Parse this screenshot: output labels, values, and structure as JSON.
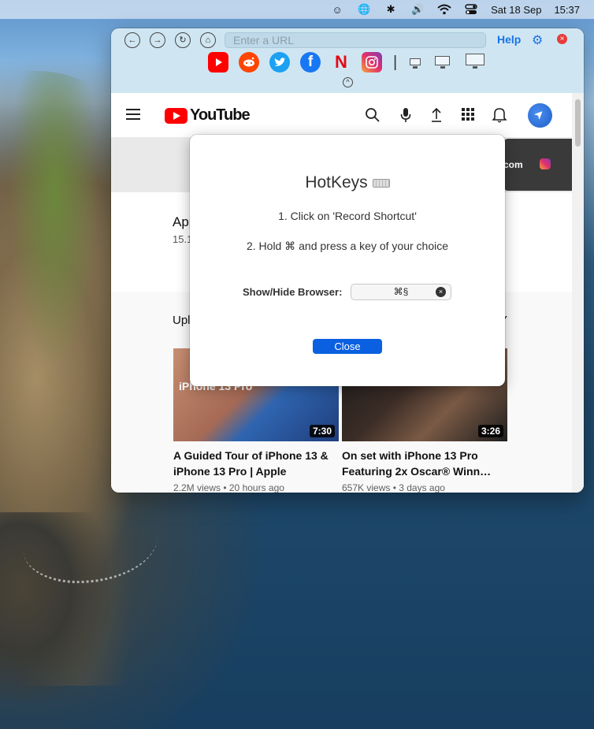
{
  "menubar": {
    "date": "Sat 18 Sep",
    "time": "15:37",
    "icons": [
      "app-icon",
      "globe-icon",
      "bluetooth-icon",
      "volume-icon",
      "wifi-icon",
      "control-center-icon"
    ]
  },
  "toolbar": {
    "url_placeholder": "Enter a URL",
    "help_label": "Help",
    "shortcuts": [
      "YouTube",
      "Reddit",
      "Twitter",
      "Facebook",
      "Netflix",
      "Instagram"
    ],
    "colors": {
      "youtube": "#ff0000",
      "reddit": "#ff4500",
      "twitter": "#1da1f2",
      "facebook": "#1877f2",
      "netflix": "#e50914",
      "instagram": "#d6249f"
    }
  },
  "youtube": {
    "logo_text": "YouTube",
    "channel_title": "App",
    "channel_sub": "15.1",
    "banner_text": "com",
    "section_title": "Upl",
    "section_right": "Y",
    "videos": [
      {
        "thumb_text": "iPhone 13 Pro",
        "duration": "7:30",
        "title": "A Guided Tour of iPhone 13 & iPhone 13 Pro | Apple",
        "meta": "2.2M views • 20 hours ago"
      },
      {
        "duration": "3:26",
        "title": "On set with iPhone 13 Pro Featuring 2x Oscar® Winn…",
        "meta": "657K views • 3 days ago"
      }
    ]
  },
  "modal": {
    "title": "HotKeys",
    "step1": "1. Click on 'Record Shortcut'",
    "step2": "2. Hold ⌘ and press a key of your choice",
    "hotkey_label": "Show/Hide Browser:",
    "hotkey_value": "⌘§",
    "close_label": "Close"
  }
}
